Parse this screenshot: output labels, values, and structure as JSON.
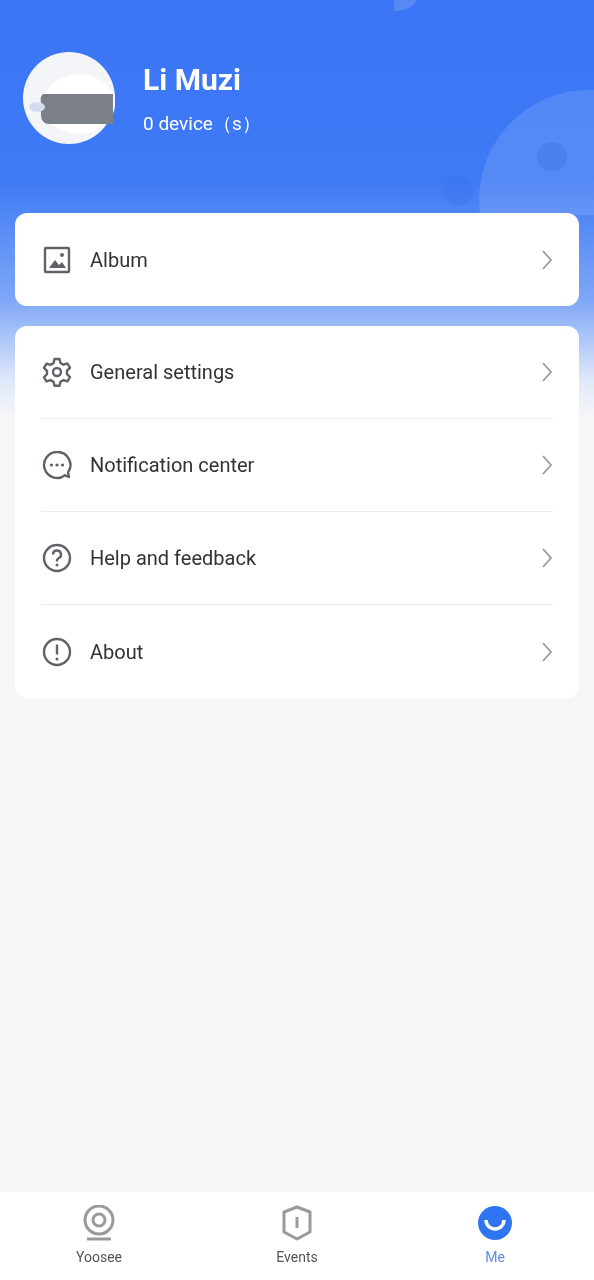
{
  "profile": {
    "name": "Li Muzi",
    "devices": "0 device（s）"
  },
  "album": {
    "label": "Album",
    "kind": "image"
  },
  "menu": [
    {
      "label": "General settings",
      "kind": "gear"
    },
    {
      "label": "Notification center",
      "kind": "chat"
    },
    {
      "label": "Help and feedback",
      "kind": "help"
    },
    {
      "label": "About",
      "kind": "info"
    }
  ],
  "tabs": [
    {
      "label": "Yoosee",
      "kind": "camera",
      "selected": false
    },
    {
      "label": "Events",
      "kind": "shield",
      "selected": false
    },
    {
      "label": "Me",
      "kind": "smile",
      "selected": true
    }
  ]
}
